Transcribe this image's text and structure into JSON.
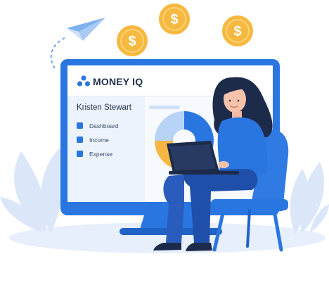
{
  "app": {
    "brand_name": "MONEY IQ",
    "user_name": "Kristen Stewart"
  },
  "sidebar": {
    "items": [
      {
        "label": "Dashboard",
        "icon": "square-icon"
      },
      {
        "label": "Income",
        "icon": "square-icon"
      },
      {
        "label": "Expense",
        "icon": "square-icon"
      }
    ]
  },
  "illustration": {
    "coin_symbol": "$",
    "coin_count": 3,
    "pie_chart": {
      "segments": [
        {
          "label": "",
          "value": 45,
          "color": "#2a76e0"
        },
        {
          "label": "",
          "value": 30,
          "color": "#f5b642"
        },
        {
          "label": "",
          "value": 25,
          "color": "#b7d3f6"
        }
      ]
    }
  },
  "colors": {
    "primary": "#2a76e0",
    "dark": "#1f2f4d",
    "coin": "#f6b83e",
    "light_bg": "#e3eefc"
  }
}
